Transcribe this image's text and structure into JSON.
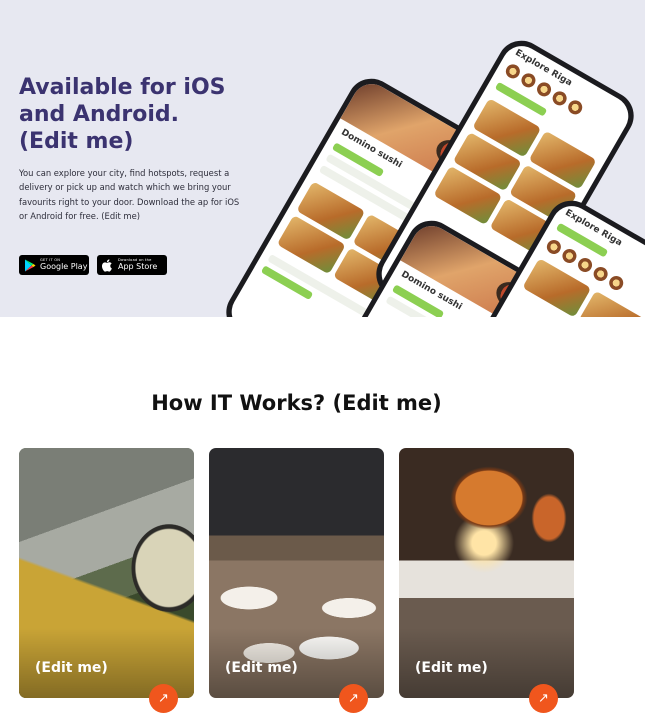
{
  "hero": {
    "title_lines": [
      "Available for iOS",
      "and Android.",
      "(Edit me)"
    ],
    "description": "You can explore your city, find hotspots, request a delivery or pick up and watch which we bring your favourits right to your door. Download the ap for iOS or Android for free. (Edit me)",
    "google_play": {
      "small": "GET IT ON",
      "big": "Google Play"
    },
    "app_store": {
      "small": "Download on the",
      "big": "App Store"
    }
  },
  "phones": {
    "screen1_title": "Domino sushi",
    "screen2_title": "Explore Riga",
    "screen3_title": "Domino sushi",
    "screen4_title": "Explore Riga"
  },
  "how": {
    "title": "How IT Works? (Edit me)",
    "cards": [
      {
        "label": "(Edit me)"
      },
      {
        "label": "(Edit me)"
      },
      {
        "label": "(Edit me)"
      }
    ]
  },
  "colors": {
    "hero_bg": "#e7e8f1",
    "title_color": "#3b3370",
    "accent": "#f0561d",
    "app_green": "#7bc043"
  }
}
